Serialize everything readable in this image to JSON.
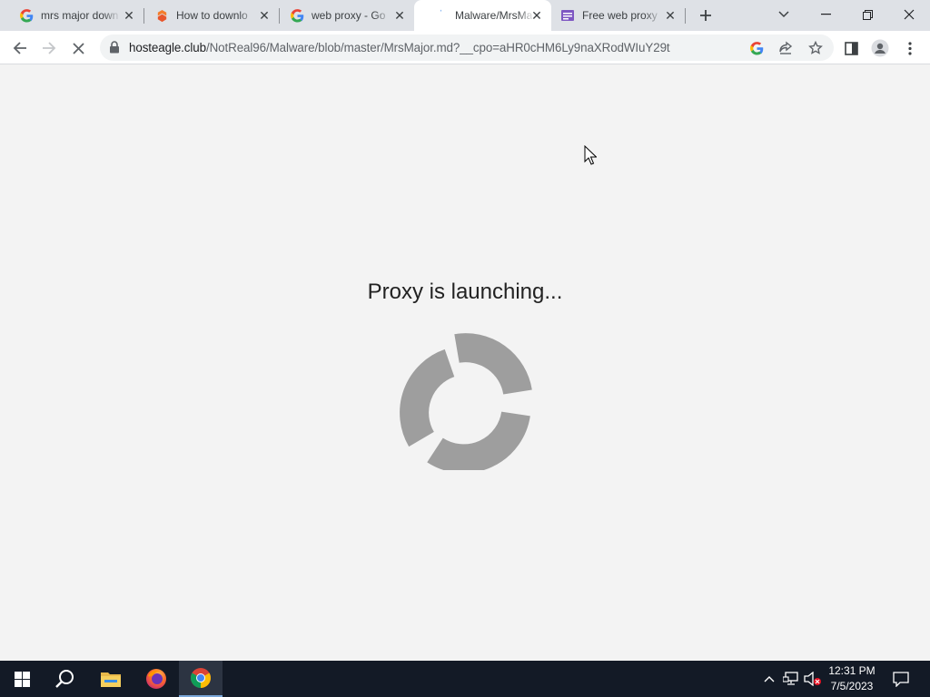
{
  "browser": {
    "tabs": [
      {
        "title": "mrs major down",
        "favicon": "google-icon",
        "active": false
      },
      {
        "title": "How to downlo",
        "favicon": "site-orange-icon",
        "active": false
      },
      {
        "title": "web proxy - Go",
        "favicon": "google-icon",
        "active": false
      },
      {
        "title": "Malware/MrsMa",
        "favicon": "loading-icon",
        "active": true
      },
      {
        "title": "Free web proxy",
        "favicon": "proxy-site-icon",
        "active": false
      }
    ],
    "url_host": "hosteagle.club",
    "url_path": "/NotReal96/Malware/blob/master/MrsMajor.md?__cpo=aHR0cHM6Ly9naXRodWIuY29t"
  },
  "page": {
    "message": "Proxy is launching..."
  },
  "taskbar": {
    "time": "12:31 PM",
    "date": "7/5/2023"
  },
  "colors": {
    "spinner": "#9e9e9e",
    "taskbar": "#131a26",
    "tab_strip": "#dee1e6"
  }
}
